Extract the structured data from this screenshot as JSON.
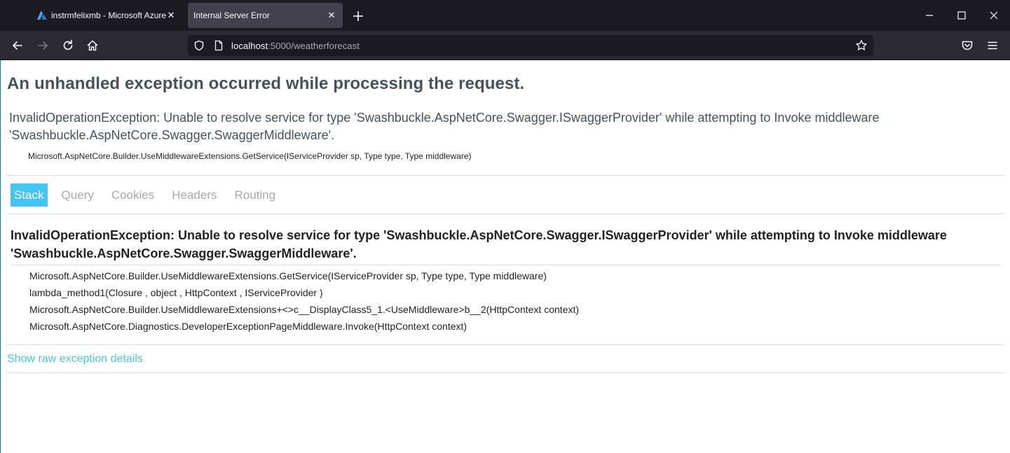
{
  "browser": {
    "tabs": [
      {
        "title": "instrmfelixmb - Microsoft Azure",
        "favicon": "azure-logo-icon",
        "active": false
      },
      {
        "title": "Internal Server Error",
        "favicon": "",
        "active": true
      }
    ],
    "tab_close_glyph": "✕",
    "url": {
      "host": "localhost",
      "rest": ":5000/weatherforecast"
    },
    "icons": {
      "back": "back-arrow-icon",
      "forward": "forward-arrow-icon",
      "reload": "reload-icon",
      "home": "home-icon",
      "shield": "shield-icon",
      "page": "page-icon",
      "bookmark": "star-icon",
      "pocket": "pocket-icon",
      "menu": "hamburger-menu-icon",
      "minimize": "minimize-icon",
      "maximize": "maximize-icon",
      "close": "close-icon",
      "new_tab": "plus-icon"
    },
    "colors": {
      "chrome_dark": "#1c1b22",
      "chrome_toolbar": "#2b2a33",
      "active_tab": "#42414d"
    }
  },
  "error_page": {
    "title": "An unhandled exception occurred while processing the request.",
    "message": "InvalidOperationException: Unable to resolve service for type 'Swashbuckle.AspNetCore.Swagger.ISwaggerProvider' while attempting to Invoke middleware 'Swashbuckle.AspNetCore.Swagger.SwaggerMiddleware'.",
    "location": "Microsoft.AspNetCore.Builder.UseMiddlewareExtensions.GetService(IServiceProvider sp, Type type, Type middleware)",
    "tabs": [
      {
        "label": "Stack",
        "selected": true
      },
      {
        "label": "Query",
        "selected": false
      },
      {
        "label": "Cookies",
        "selected": false
      },
      {
        "label": "Headers",
        "selected": false
      },
      {
        "label": "Routing",
        "selected": false
      }
    ],
    "stack": {
      "heading": "InvalidOperationException: Unable to resolve service for type 'Swashbuckle.AspNetCore.Swagger.ISwaggerProvider' while attempting to Invoke middleware 'Swashbuckle.AspNetCore.Swagger.SwaggerMiddleware'.",
      "frames": [
        "Microsoft.AspNetCore.Builder.UseMiddlewareExtensions.GetService(IServiceProvider sp, Type type, Type middleware)",
        "lambda_method1(Closure , object , HttpContext , IServiceProvider )",
        "Microsoft.AspNetCore.Builder.UseMiddlewareExtensions+<>c__DisplayClass5_1.<UseMiddleware>b__2(HttpContext context)",
        "Microsoft.AspNetCore.Diagnostics.DeveloperExceptionPageMiddleware.Invoke(HttpContext context)"
      ]
    },
    "raw_link": "Show raw exception details",
    "colors": {
      "accent": "#44c5f2",
      "title_text": "#44525e",
      "body_text": "#222222",
      "inactive_tab": "#a8a8a8"
    }
  }
}
